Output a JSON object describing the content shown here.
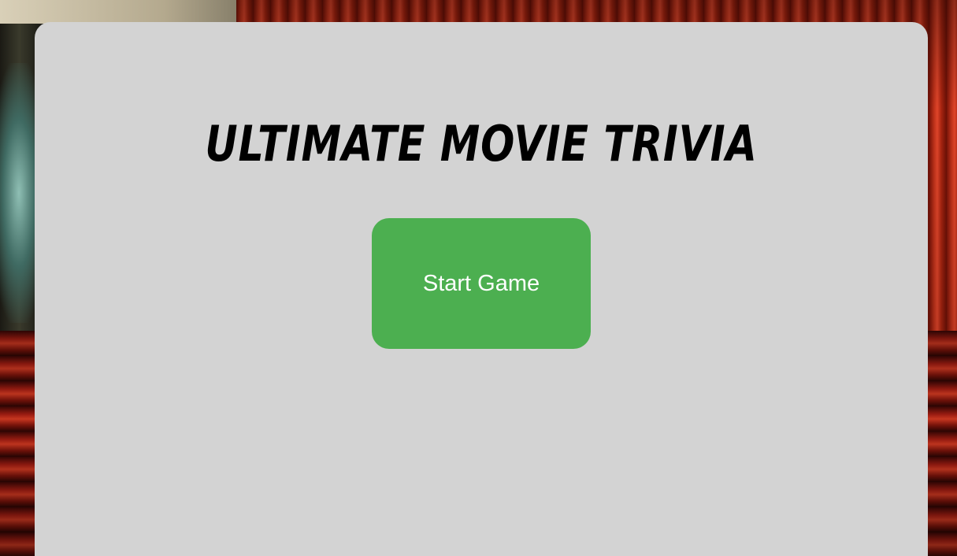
{
  "app": {
    "title": "Ultimate Movie Trivia",
    "start_button_label": "Start Game"
  },
  "colors": {
    "panel_background": "#d3d3d3",
    "start_button_background": "#4caf50",
    "start_button_text": "#ffffff",
    "title_text": "#000000"
  },
  "background": {
    "image": "cinema-theater-red-curtain-and-seats"
  }
}
